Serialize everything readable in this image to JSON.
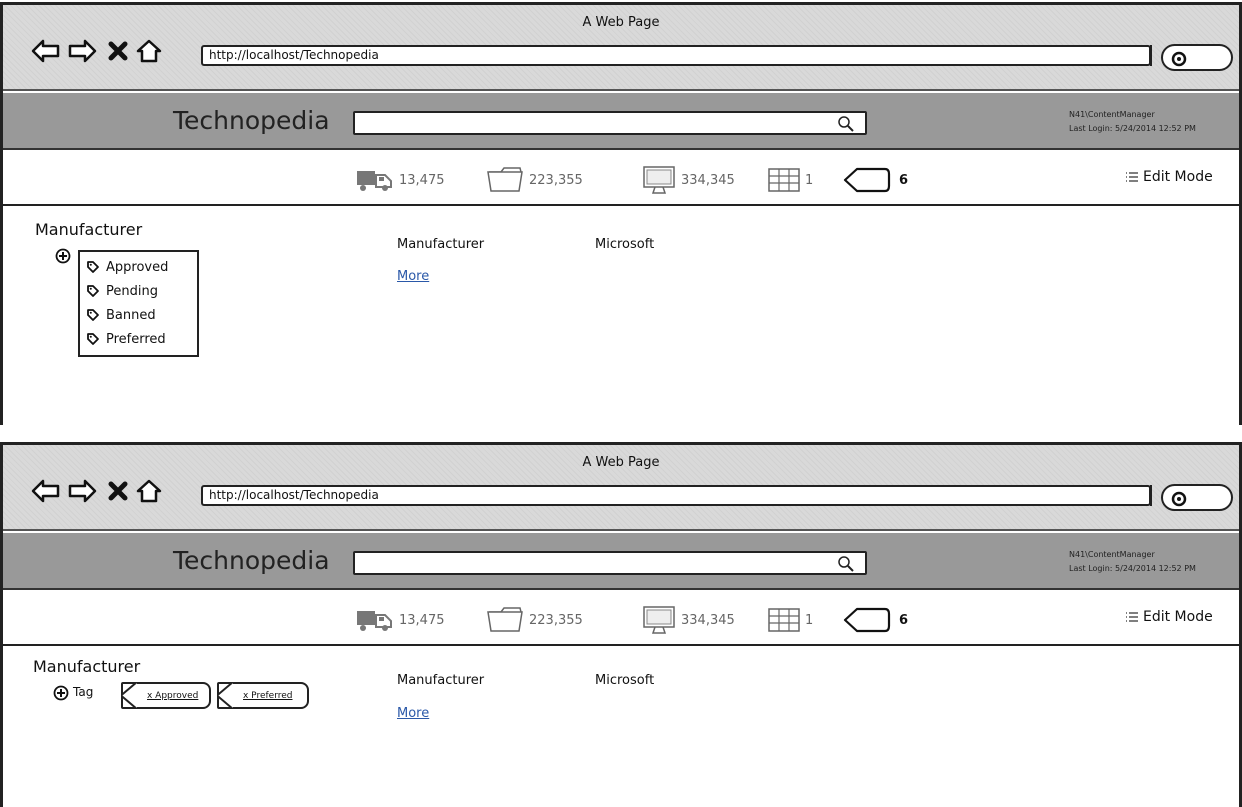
{
  "browser": {
    "window_title": "A Web Page",
    "url": "http://localhost/Technopedia"
  },
  "app": {
    "title": "Technopedia",
    "search_value": "",
    "user": "N41\\ContentManager",
    "last_login": "Last Login: 5/24/2014 12:52 PM"
  },
  "stats": {
    "trucks": "13,475",
    "folders": "223,355",
    "computers": "334,345",
    "tables": "1",
    "tags": "6"
  },
  "edit_mode_label": "Edit Mode",
  "content": {
    "section_heading": "Manufacturer",
    "detail_label": "Manufacturer",
    "detail_value": "Microsoft",
    "more_link": "More"
  },
  "tag_options": [
    "Approved",
    "Pending",
    "Banned",
    "Preferred"
  ],
  "tag_word": "Tag",
  "selected_tags": [
    "x Approved",
    "x Preferred"
  ],
  "icons": [
    "back-arrow-icon",
    "forward-arrow-icon",
    "stop-icon",
    "home-icon",
    "search-icon",
    "truck-icon",
    "folder-icon",
    "monitor-icon",
    "table-icon",
    "tag-shape-icon",
    "list-icon",
    "plus-circle-icon",
    "tag-icon"
  ]
}
